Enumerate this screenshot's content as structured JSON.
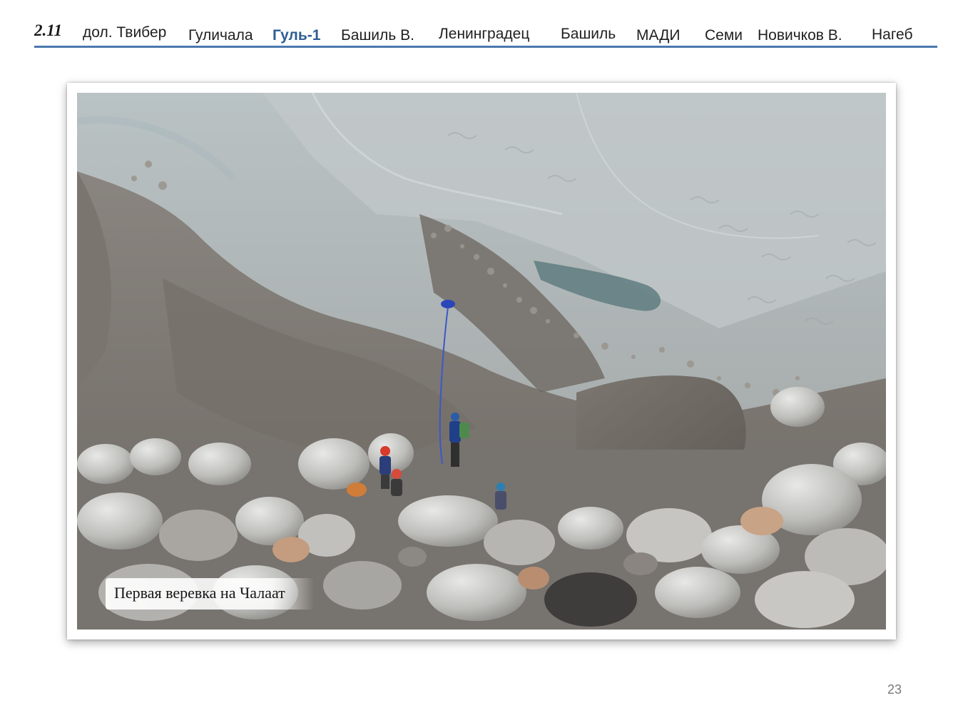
{
  "header": {
    "section_number": "2.11",
    "nav_items": [
      {
        "label": "дол. Твибер",
        "active": false
      },
      {
        "label": "Гуличала",
        "active": false
      },
      {
        "label": "Гуль-1",
        "active": true
      },
      {
        "label": "Башиль В.",
        "active": false
      },
      {
        "label": "Ленинградец",
        "active": false
      },
      {
        "label": "Башиль",
        "active": false
      },
      {
        "label": "МАДИ",
        "active": false
      },
      {
        "label": "Семи",
        "active": false
      },
      {
        "label": "Новичков В.",
        "active": false
      },
      {
        "label": "Нагеб",
        "active": false
      }
    ],
    "accent_color": "#4a78ad",
    "active_color": "#2e5d93"
  },
  "photo": {
    "caption": "Первая веревка на Чалаат"
  },
  "footer": {
    "page_number": "23"
  }
}
